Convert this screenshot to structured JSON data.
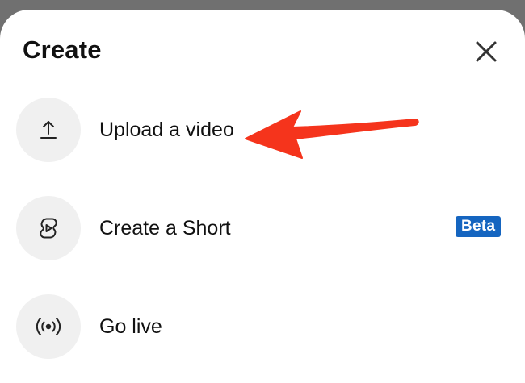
{
  "sheet": {
    "title": "Create",
    "close_icon": "close-icon"
  },
  "items": [
    {
      "label": "Upload a video",
      "icon": "upload-icon"
    },
    {
      "label": "Create a Short",
      "icon": "shorts-icon",
      "badge": "Beta"
    },
    {
      "label": "Go live",
      "icon": "live-broadcast-icon"
    }
  ],
  "colors": {
    "backdrop": "#707070",
    "sheet": "#ffffff",
    "icon_circle": "#f0f0f0",
    "badge": "#1565c0",
    "annotation_arrow": "#f5341c"
  }
}
